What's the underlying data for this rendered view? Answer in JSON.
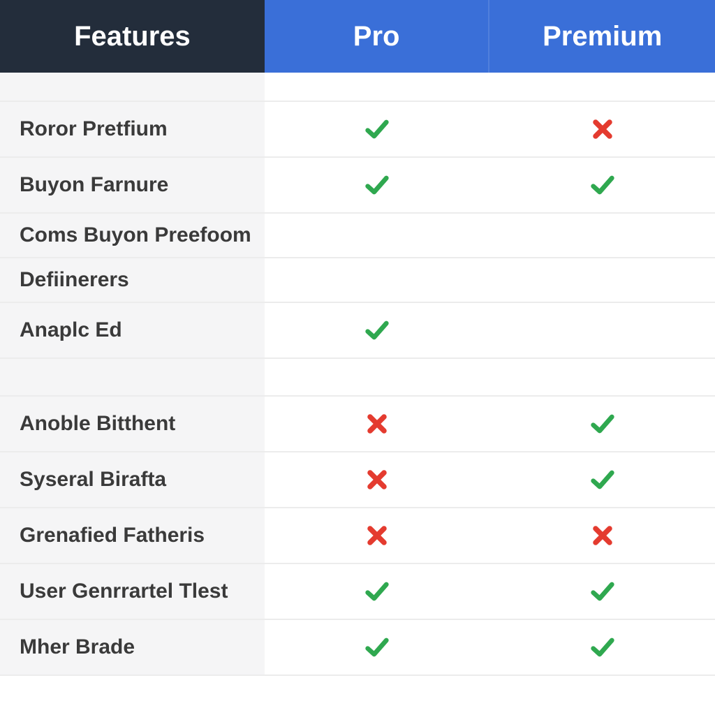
{
  "columns": {
    "features": "Features",
    "pro": "Pro",
    "premium": "Premium"
  },
  "rows": [
    {
      "label": "Roror Pretfium",
      "pro": "check",
      "premium": "cross"
    },
    {
      "label": "Buyon Farnure",
      "pro": "check",
      "premium": "check"
    },
    {
      "label": "Coms Buyon Preefoom",
      "pro": "",
      "premium": ""
    },
    {
      "label": "Defiinerers",
      "pro": "",
      "premium": ""
    },
    {
      "label": "Anaplc Ed",
      "pro": "check",
      "premium": ""
    },
    {
      "label": "Anoble Bitthent",
      "pro": "cross",
      "premium": "check"
    },
    {
      "label": "Syseral Birafta",
      "pro": "cross",
      "premium": "check"
    },
    {
      "label": "Grenafied Fatheris",
      "pro": "cross",
      "premium": "cross"
    },
    {
      "label": "User Genrrartel Tlest",
      "pro": "check",
      "premium": "check"
    },
    {
      "label": "Mher Brade",
      "pro": "check",
      "premium": "check"
    }
  ],
  "icons": {
    "check": "check-icon",
    "cross": "cross-icon"
  }
}
